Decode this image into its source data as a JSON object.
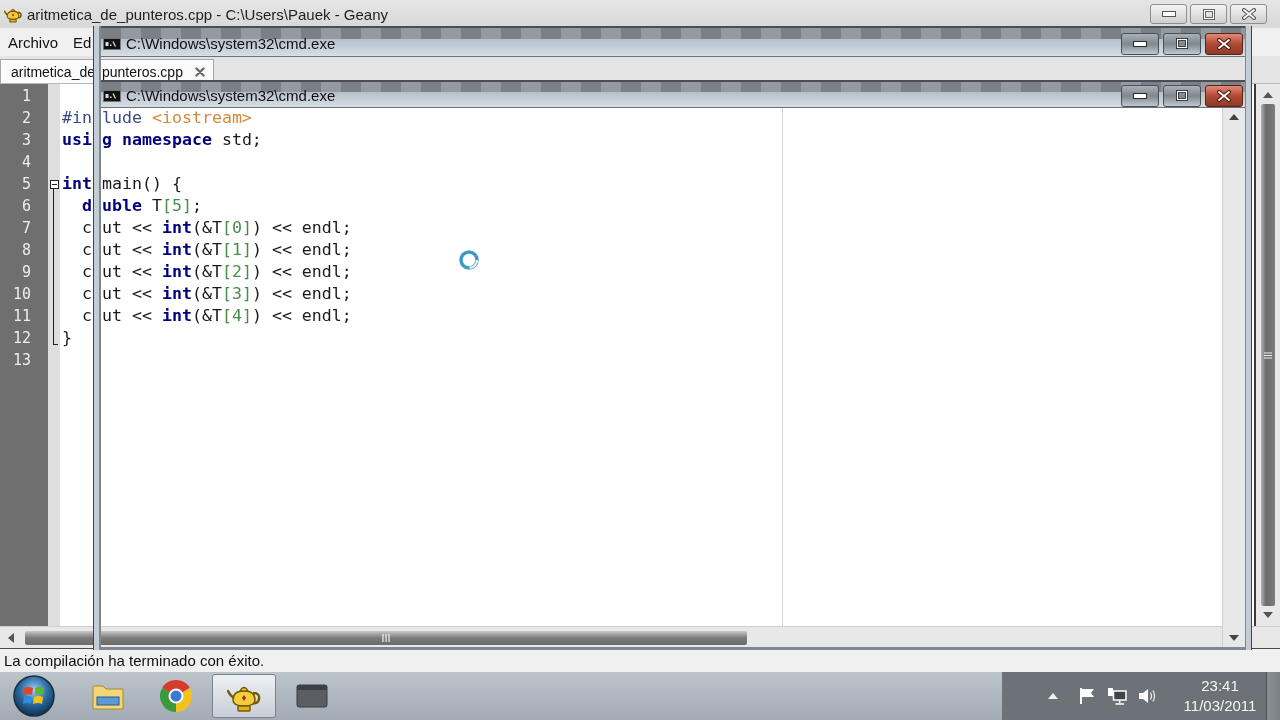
{
  "window": {
    "title": "aritmetica_de_punteros.cpp - C:\\Users\\Pauek - Geany"
  },
  "menu": [
    {
      "label": "Archivo"
    },
    {
      "label": "Ed"
    }
  ],
  "overlay_windows": [
    {
      "title": "C:\\Windows\\system32\\cmd.exe"
    },
    {
      "title": "C:\\Windows\\system32\\cmd.exe"
    }
  ],
  "tabs": [
    {
      "label_pieces": [
        "aritmetica_de",
        "punteros.cpp"
      ],
      "selected": true
    }
  ],
  "editor": {
    "lines": [
      {
        "number": "1"
      },
      {
        "number": "2",
        "left": [
          {
            "text": "#in",
            "kind": "preprocessor"
          }
        ],
        "right": [
          {
            "text": "lude ",
            "kind": "preprocessor"
          },
          {
            "text": "<iostream>",
            "kind": "include"
          }
        ]
      },
      {
        "number": "3",
        "left": [
          {
            "text": "usi",
            "kind": "keyword"
          }
        ],
        "right": [
          {
            "text": "g namespace",
            "kind": "keyword"
          },
          {
            "text": " std;",
            "kind": "plain"
          }
        ]
      },
      {
        "number": "4"
      },
      {
        "number": "5",
        "left": [
          {
            "text": "int",
            "kind": "keyword"
          }
        ],
        "right": [
          {
            "text": "main() {",
            "kind": "plain"
          }
        ],
        "expanded": true,
        "children": [
          {
            "number": "6",
            "left": [
              {
                "text": "d",
                "kind": "keyword"
              }
            ],
            "right": [
              {
                "text": "uble",
                "kind": "keyword"
              },
              {
                "text": " T",
                "kind": "plain"
              },
              {
                "text": "[5]",
                "kind": "number"
              },
              {
                "text": ";",
                "kind": "plain"
              }
            ]
          },
          {
            "number": "7",
            "left": [
              {
                "text": "c",
                "kind": "plain"
              }
            ],
            "right": [
              {
                "text": "ut << ",
                "kind": "plain"
              },
              {
                "text": "int",
                "kind": "keyword"
              },
              {
                "text": "(&T",
                "kind": "plain"
              },
              {
                "text": "[0]",
                "kind": "number"
              },
              {
                "text": ") << endl;",
                "kind": "plain"
              }
            ]
          },
          {
            "number": "8",
            "left": [
              {
                "text": "c",
                "kind": "plain"
              }
            ],
            "right": [
              {
                "text": "ut << ",
                "kind": "plain"
              },
              {
                "text": "int",
                "kind": "keyword"
              },
              {
                "text": "(&T",
                "kind": "plain"
              },
              {
                "text": "[1]",
                "kind": "number"
              },
              {
                "text": ") << endl;",
                "kind": "plain"
              }
            ]
          },
          {
            "number": "9",
            "left": [
              {
                "text": "c",
                "kind": "plain"
              }
            ],
            "right": [
              {
                "text": "ut << ",
                "kind": "plain"
              },
              {
                "text": "int",
                "kind": "keyword"
              },
              {
                "text": "(&T",
                "kind": "plain"
              },
              {
                "text": "[2]",
                "kind": "number"
              },
              {
                "text": ") << endl;",
                "kind": "plain"
              }
            ]
          },
          {
            "number": "10",
            "left": [
              {
                "text": "c",
                "kind": "plain"
              }
            ],
            "right": [
              {
                "text": "ut << ",
                "kind": "plain"
              },
              {
                "text": "int",
                "kind": "keyword"
              },
              {
                "text": "(&T",
                "kind": "plain"
              },
              {
                "text": "[3]",
                "kind": "number"
              },
              {
                "text": ") << endl;",
                "kind": "plain"
              }
            ]
          },
          {
            "number": "11",
            "left": [
              {
                "text": "c",
                "kind": "plain"
              }
            ],
            "right": [
              {
                "text": "ut << ",
                "kind": "plain"
              },
              {
                "text": "int",
                "kind": "keyword"
              },
              {
                "text": "(&T",
                "kind": "plain"
              },
              {
                "text": "[4]",
                "kind": "number"
              },
              {
                "text": ") << endl;",
                "kind": "plain"
              }
            ]
          }
        ],
        "end": {
          "number": "12",
          "left": [
            {
              "text": "}",
              "kind": "plain"
            }
          ]
        }
      },
      {
        "number": "13"
      }
    ]
  },
  "status_bar": {
    "message": "La compilación ha terminado con éxito."
  },
  "taskbar": {
    "apps": [
      {
        "selected": false
      },
      {
        "selected": false
      },
      {
        "selected": true
      },
      {
        "selected": false
      }
    ],
    "clock": {
      "time": "23:41",
      "date": "11/03/2011"
    }
  }
}
